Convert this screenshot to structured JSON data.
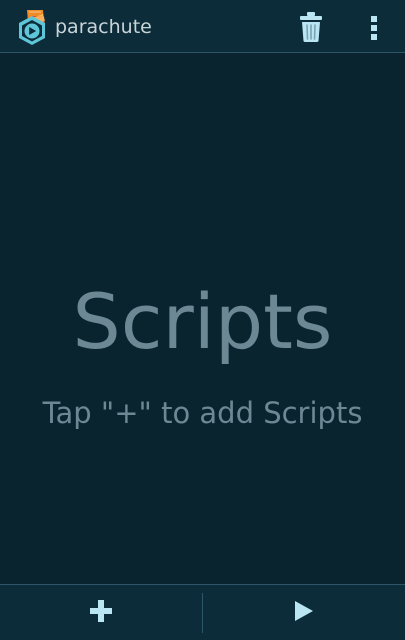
{
  "action_bar": {
    "title": "parachute",
    "logo_icon": "parachute-logo-icon",
    "actions": [
      {
        "icon": "trash-icon"
      },
      {
        "icon": "overflow-menu-icon"
      }
    ]
  },
  "empty_state": {
    "title": "Scripts",
    "hint": "Tap \"+\" to add Scripts"
  },
  "bottom_bar": {
    "buttons": [
      {
        "icon": "plus-icon"
      },
      {
        "icon": "play-icon"
      }
    ]
  },
  "colors": {
    "background": "#0a242f",
    "bar": "#0c2c3a",
    "accent": "#b9e6f2",
    "empty_text": "#6c8894",
    "logo_orange": "#f08a24"
  }
}
